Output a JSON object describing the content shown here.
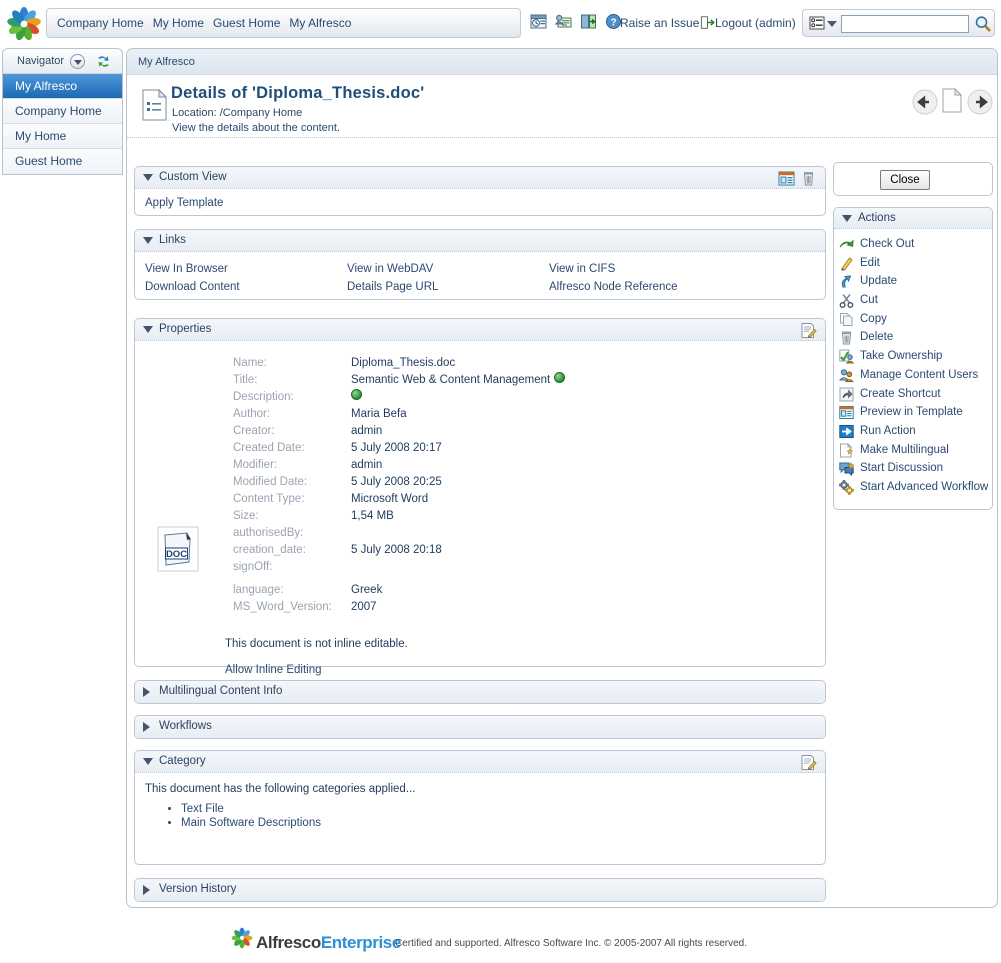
{
  "topbar": {
    "nav_links": [
      "Company Home",
      "My Home",
      "Guest Home",
      "My Alfresco"
    ],
    "tool_icons": [
      "schedule-icon",
      "user-details-icon",
      "exit-door-icon",
      "help-icon"
    ],
    "raise_issue": "Raise an Issue",
    "logout": "Logout (admin)",
    "search_placeholder": "",
    "search_value": ""
  },
  "sidebar": {
    "header": "Navigator",
    "items": [
      {
        "label": "My Alfresco",
        "selected": true
      },
      {
        "label": "Company Home",
        "selected": false
      },
      {
        "label": "My Home",
        "selected": false
      },
      {
        "label": "Guest Home",
        "selected": false
      }
    ]
  },
  "breadcrumb": "My Alfresco",
  "header": {
    "title": "Details of 'Diploma_Thesis.doc'",
    "location": "Location: /Company Home",
    "subtitle": "View the details about the content."
  },
  "custom_view": {
    "title": "Custom View",
    "apply_template": "Apply Template"
  },
  "links": {
    "title": "Links",
    "col1": [
      "View In Browser",
      "Download Content"
    ],
    "col2": [
      "View in WebDAV",
      "Details Page URL"
    ],
    "col3": [
      "View in CIFS",
      "Alfresco Node Reference"
    ]
  },
  "properties": {
    "title": "Properties",
    "rows": [
      {
        "label": "Name:",
        "value": "Diploma_Thesis.doc",
        "globe": false
      },
      {
        "label": "Title:",
        "value": "Semantic Web & Content Management",
        "globe": true
      },
      {
        "label": "Description:",
        "value": "",
        "globe": true
      },
      {
        "label": "Author:",
        "value": "Maria Befa",
        "globe": false
      },
      {
        "label": "Creator:",
        "value": "admin",
        "globe": false
      },
      {
        "label": "Created Date:",
        "value": "5 July 2008 20:17",
        "globe": false
      },
      {
        "label": "Modifier:",
        "value": "admin",
        "globe": false
      },
      {
        "label": "Modified Date:",
        "value": "5 July 2008 20:25",
        "globe": false
      },
      {
        "label": "Content Type:",
        "value": "Microsoft Word",
        "globe": false
      },
      {
        "label": "Size:",
        "value": "1,54 MB",
        "globe": false
      },
      {
        "label": "authorisedBy:",
        "value": "",
        "globe": false
      },
      {
        "label": "creation_date:",
        "value": "5 July 2008 20:18",
        "globe": false
      },
      {
        "label": "signOff:",
        "value": "",
        "globe": false
      },
      {
        "label": "language:",
        "value": "Greek",
        "globe": false
      },
      {
        "label": "MS_Word_Version:",
        "value": "2007",
        "globe": false
      }
    ],
    "inline_note": "This document is not inline editable.",
    "allow_inline": "Allow Inline Editing",
    "doc_icon_label": "DOC"
  },
  "multilingual": {
    "title": "Multilingual Content Info"
  },
  "workflows": {
    "title": "Workflows"
  },
  "category": {
    "title": "Category",
    "intro": "This document has the following categories applied...",
    "items": [
      "Text File",
      "Main Software Descriptions"
    ]
  },
  "version_history": {
    "title": "Version History"
  },
  "right": {
    "close_label": "Close",
    "actions_title": "Actions",
    "actions": [
      {
        "label": "Check Out",
        "icon": "check-out-icon"
      },
      {
        "label": "Edit",
        "icon": "pencil-icon"
      },
      {
        "label": "Update",
        "icon": "update-arrow-icon"
      },
      {
        "label": "Cut",
        "icon": "scissors-icon"
      },
      {
        "label": "Copy",
        "icon": "copy-pages-icon"
      },
      {
        "label": "Delete",
        "icon": "trash-icon"
      },
      {
        "label": "Take Ownership",
        "icon": "take-ownership-icon"
      },
      {
        "label": "Manage Content Users",
        "icon": "users-icon"
      },
      {
        "label": "Create Shortcut",
        "icon": "shortcut-arrow-icon"
      },
      {
        "label": "Preview in Template",
        "icon": "preview-template-icon"
      },
      {
        "label": "Run Action",
        "icon": "run-action-icon"
      },
      {
        "label": "Make Multilingual",
        "icon": "multilingual-page-icon"
      },
      {
        "label": "Start Discussion",
        "icon": "discussion-bubble-icon"
      },
      {
        "label": "Start Advanced Workflow",
        "icon": "advanced-workflow-icon"
      }
    ]
  },
  "footer": {
    "brand_main": "Alfresco",
    "brand_sub": "Enterprise",
    "copyright": "Certified and supported. Alfresco Software Inc. © 2005-2007 All rights reserved."
  },
  "colors": {
    "selected_sidebar": "#1b69b5",
    "link": "#2b4a72",
    "title": "#1f4e79",
    "enterprise_blue": "#2a8fd4"
  }
}
